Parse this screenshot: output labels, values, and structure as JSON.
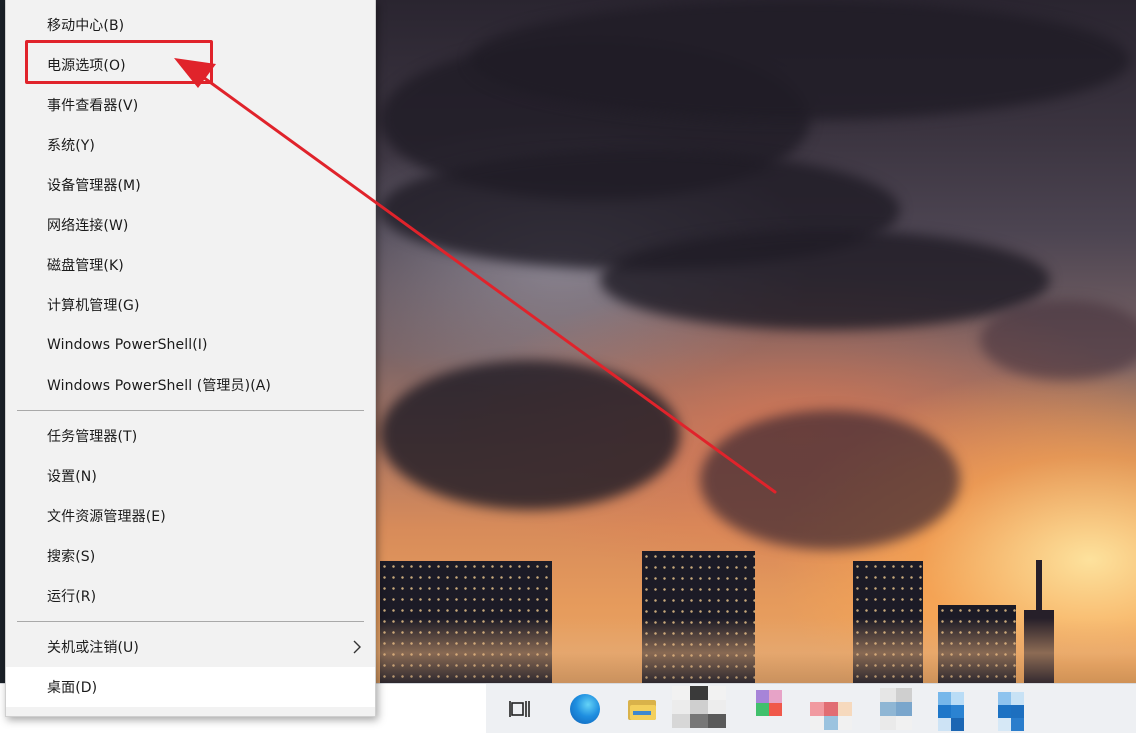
{
  "context_menu": {
    "items": [
      {
        "label": "移动中心(B)"
      },
      {
        "label": "电源选项(O)"
      },
      {
        "label": "事件查看器(V)"
      },
      {
        "label": "系统(Y)"
      },
      {
        "label": "设备管理器(M)"
      },
      {
        "label": "网络连接(W)"
      },
      {
        "label": "磁盘管理(K)"
      },
      {
        "label": "计算机管理(G)"
      },
      {
        "label": "Windows PowerShell(I)"
      },
      {
        "label": "Windows PowerShell (管理员)(A)"
      },
      {
        "label": "任务管理器(T)"
      },
      {
        "label": "设置(N)"
      },
      {
        "label": "文件资源管理器(E)"
      },
      {
        "label": "搜索(S)"
      },
      {
        "label": "运行(R)"
      },
      {
        "label": "关机或注销(U)"
      },
      {
        "label": "桌面(D)"
      }
    ],
    "hovered_item": "桌面(D)",
    "highlighted_item": "电源选项(O)"
  },
  "annotation": {
    "color": "#e0232b",
    "type": "arrow-and-box",
    "target": "电源选项(O)"
  },
  "taskbar": {
    "icons": [
      "task-view-icon",
      "edge-icon",
      "file-explorer-icon",
      "pixelated-app-icon-1",
      "pixelated-app-icon-2",
      "pixelated-app-icon-3",
      "pixelated-app-icon-4",
      "pixelated-app-icon-5",
      "pixelated-app-icon-6",
      "pixelated-app-icon-7"
    ]
  }
}
